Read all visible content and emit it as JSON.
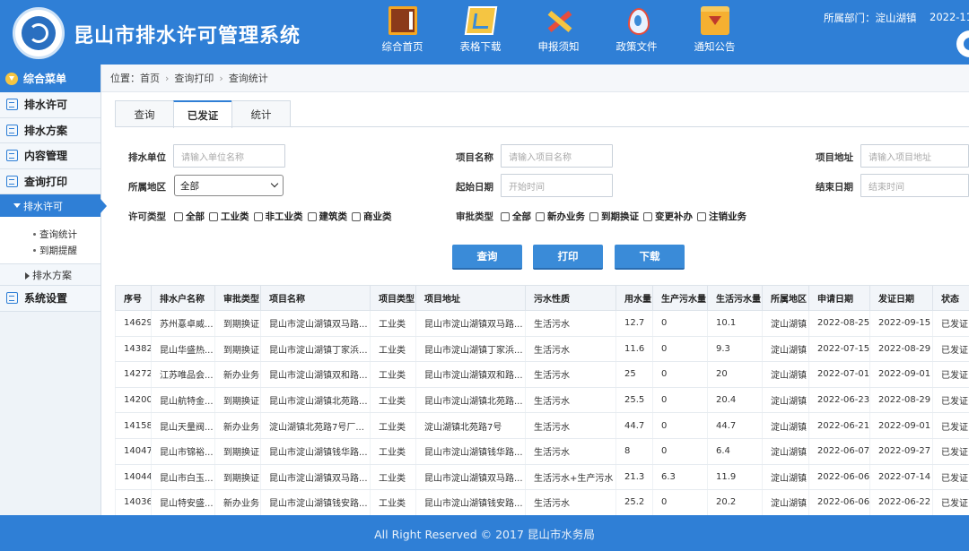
{
  "header": {
    "title": "昆山市排水许可管理系统",
    "dept": "所属部门：淀山湖镇",
    "date": "2022-11",
    "nav": [
      {
        "label": "综合首页",
        "icon": "book-icon"
      },
      {
        "label": "表格下载",
        "icon": "form-download-icon"
      },
      {
        "label": "申报须知",
        "icon": "tools-icon"
      },
      {
        "label": "政策文件",
        "icon": "water-drop-icon"
      },
      {
        "label": "通知公告",
        "icon": "folder-notice-icon"
      }
    ]
  },
  "sidebar": {
    "head": "综合菜单",
    "items": [
      "排水许可",
      "排水方案",
      "内容管理",
      "查询打印"
    ],
    "active_sub": "排水许可",
    "leaves": [
      "查询统计",
      "到期提醒"
    ],
    "sub2": "排水方案",
    "last": "系统设置"
  },
  "breadcrumb": {
    "prefix": "位置：",
    "items": [
      "首页",
      "查询打印",
      "查询统计"
    ]
  },
  "tabs": [
    "查询",
    "已发证",
    "统计"
  ],
  "filters": {
    "unit_label": "排水单位",
    "unit_ph": "请输入单位名称",
    "project_label": "项目名称",
    "project_ph": "请输入项目名称",
    "addr_label": "项目地址",
    "addr_ph": "请输入项目地址",
    "region_label": "所属地区",
    "region_value": "全部",
    "start_label": "起始日期",
    "start_ph": "开始时间",
    "end_label": "结束日期",
    "end_ph": "结束时间",
    "permit_label": "许可类型",
    "permit_opts": [
      "全部",
      "工业类",
      "非工业类",
      "建筑类",
      "商业类"
    ],
    "approve_label": "审批类型",
    "approve_opts": [
      "全部",
      "新办业务",
      "到期换证",
      "变更补办",
      "注销业务"
    ]
  },
  "buttons": {
    "query": "查询",
    "print": "打印",
    "download": "下载"
  },
  "table": {
    "headers": [
      "序号",
      "排水户名称",
      "审批类型",
      "项目名称",
      "项目类型",
      "项目地址",
      "污水性质",
      "用水量",
      "生产污水量",
      "生活污水量",
      "所属地区",
      "申请日期",
      "发证日期",
      "状态"
    ],
    "rows": [
      [
        "14629",
        "苏州憙卓威...",
        "到期换证",
        "昆山市淀山湖镇双马路...",
        "工业类",
        "昆山市淀山湖镇双马路...",
        "生活污水",
        "12.7",
        "0",
        "10.1",
        "淀山湖镇",
        "2022-08-25",
        "2022-09-15",
        "已发证"
      ],
      [
        "14382",
        "昆山华盛热...",
        "到期换证",
        "昆山市淀山湖镇丁家浜...",
        "工业类",
        "昆山市淀山湖镇丁家浜...",
        "生活污水",
        "11.6",
        "0",
        "9.3",
        "淀山湖镇",
        "2022-07-15",
        "2022-08-29",
        "已发证"
      ],
      [
        "14272",
        "江苏唯品会...",
        "新办业务",
        "昆山市淀山湖镇双和路...",
        "工业类",
        "昆山市淀山湖镇双和路...",
        "生活污水",
        "25",
        "0",
        "20",
        "淀山湖镇",
        "2022-07-01",
        "2022-09-01",
        "已发证"
      ],
      [
        "14200",
        "昆山航特金...",
        "到期换证",
        "昆山市淀山湖镇北苑路...",
        "工业类",
        "昆山市淀山湖镇北苑路...",
        "生活污水",
        "25.5",
        "0",
        "20.4",
        "淀山湖镇",
        "2022-06-23",
        "2022-08-29",
        "已发证"
      ],
      [
        "14158",
        "昆山天量阀...",
        "新办业务",
        "淀山湖镇北苑路7号厂...",
        "工业类",
        "淀山湖镇北苑路7号",
        "生活污水",
        "44.7",
        "0",
        "44.7",
        "淀山湖镇",
        "2022-06-21",
        "2022-09-01",
        "已发证"
      ],
      [
        "14047",
        "昆山市锦裕...",
        "到期换证",
        "昆山市淀山湖镇钱华路...",
        "工业类",
        "昆山市淀山湖镇钱华路...",
        "生活污水",
        "8",
        "0",
        "6.4",
        "淀山湖镇",
        "2022-06-07",
        "2022-09-27",
        "已发证"
      ],
      [
        "14044",
        "昆山市白玉...",
        "到期换证",
        "昆山市淀山湖镇双马路...",
        "工业类",
        "昆山市淀山湖镇双马路...",
        "生活污水+生产污水",
        "21.3",
        "6.3",
        "11.9",
        "淀山湖镇",
        "2022-06-06",
        "2022-07-14",
        "已发证"
      ],
      [
        "14036",
        "昆山特安盛...",
        "新办业务",
        "昆山市淀山湖镇钱安路...",
        "工业类",
        "昆山市淀山湖镇钱安路...",
        "生活污水",
        "25.2",
        "0",
        "20.2",
        "淀山湖镇",
        "2022-06-06",
        "2022-06-22",
        "已发证"
      ]
    ]
  },
  "footer": "All Right Reserved © 2017 昆山市水务局"
}
